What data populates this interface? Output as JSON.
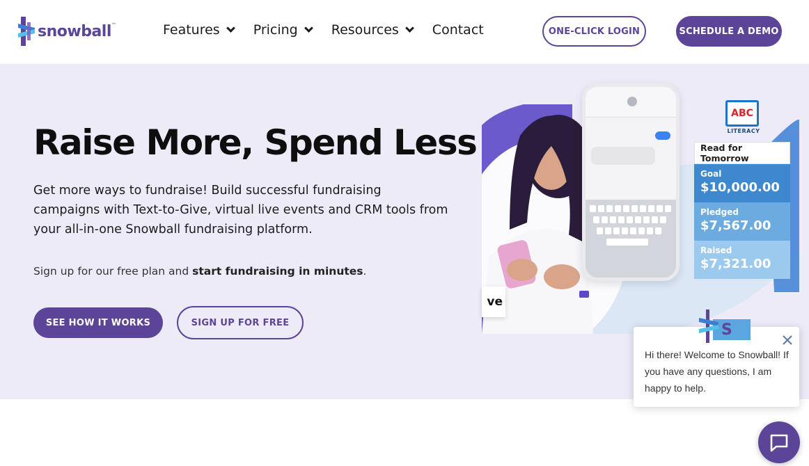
{
  "brand": {
    "name": "snowball",
    "tm": "™",
    "color": "#5c4499"
  },
  "nav": {
    "items": [
      {
        "label": "Features",
        "has_dropdown": true
      },
      {
        "label": "Pricing",
        "has_dropdown": true
      },
      {
        "label": "Resources",
        "has_dropdown": true
      },
      {
        "label": "Contact",
        "has_dropdown": false
      }
    ]
  },
  "header": {
    "login_label": "ONE-CLICK LOGIN",
    "demo_label": "SCHEDULE A DEMO"
  },
  "hero": {
    "title": "Raise More, Spend Less",
    "description": "Get more ways to fundraise! Build successful fundraising campaigns with Text-to-Give, virtual live events and CRM tools from your all-in-one Snowball fundraising platform.",
    "sub_prefix": "Sign up for our free plan and ",
    "sub_bold": "start fundraising in minutes",
    "sub_suffix": ".",
    "btn_primary": "SEE HOW IT WORKS",
    "btn_secondary": "SIGN UP FOR FREE",
    "background": "#eeebf9"
  },
  "illustration": {
    "org_logo_text": "ABC",
    "org_logo_sub": "LITERACY",
    "campaign_title": "Read for Tomorrow",
    "rows": [
      {
        "label": "Goal",
        "value": "$10,000.00"
      },
      {
        "label": "Pledged",
        "value": "$7,567.00"
      },
      {
        "label": "Raised",
        "value": "$7,321.00"
      }
    ],
    "live_tag": "ve"
  },
  "chat": {
    "message": "Hi there! Welcome to Snowball! If you have any questions, I am happy to help.",
    "avatar_letter": "S"
  },
  "icons": {
    "logo": "snowball-logo-icon",
    "chevron": "chevron-down-icon",
    "close": "close-icon",
    "chat": "chat-bubble-icon"
  }
}
